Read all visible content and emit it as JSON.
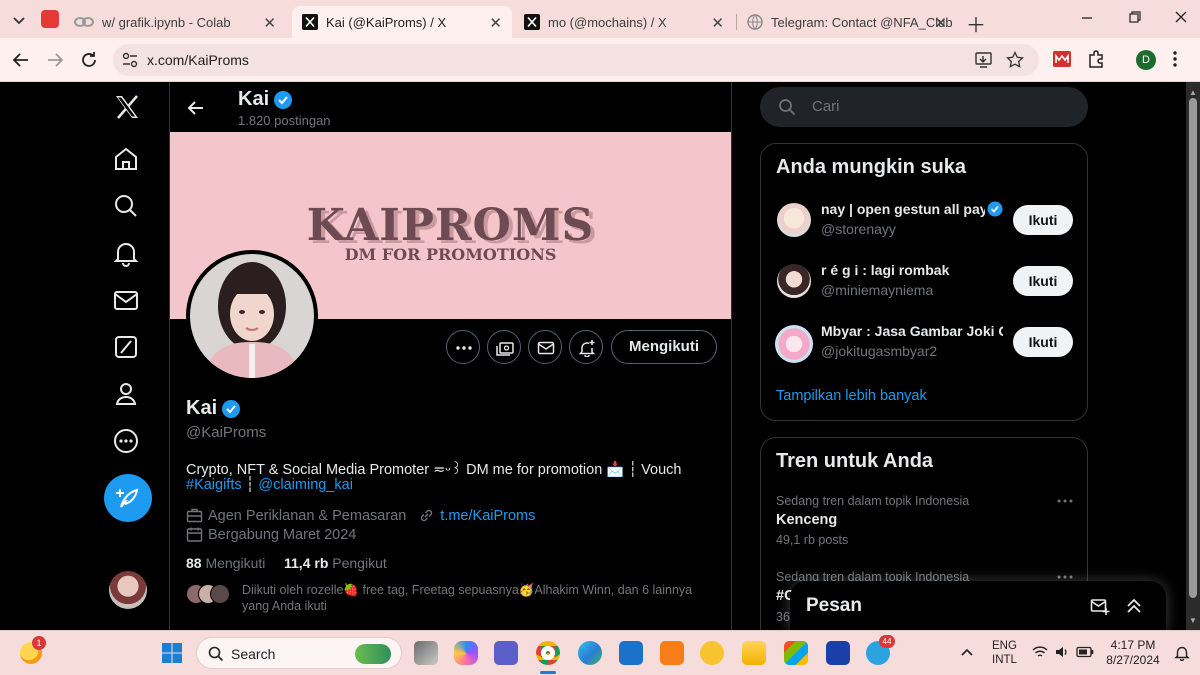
{
  "browser": {
    "tabs": [
      {
        "title": "w/ grafik.ipynb - Colab",
        "active": false
      },
      {
        "title": "Kai (@KaiProms) / X",
        "active": true
      },
      {
        "title": "mo (@mochains) / X",
        "active": false
      },
      {
        "title": "Telegram: Contact @NFA_Club",
        "active": false
      }
    ],
    "url": "x.com/KaiProms",
    "profile_letter": "D"
  },
  "header": {
    "name": "Kai",
    "post_count": "1.820 postingan"
  },
  "banner": {
    "title": "KAIPROMS",
    "subtitle": "DM FOR PROMOTIONS",
    "bg_color": "#f4c6cb"
  },
  "profile": {
    "follow_label": "Mengikuti",
    "name": "Kai",
    "handle": "@KaiProms",
    "bio_line1": "Crypto, NFT & Social Media Promoter ≂ᵕ꒱ DM me for promotion 📩 ┆ Vouch",
    "bio_tag1": "#Kaigifts",
    "bio_sep": " ┆ ",
    "bio_tag2": "@claiming_kai",
    "category": "Agen Periklanan & Pemasaran",
    "link": "t.me/KaiProms",
    "joined": "Bergabung Maret 2024",
    "following_count": "88",
    "following_label": "Mengikuti",
    "followers_count": "11,4 rb",
    "followers_label": "Pengikut",
    "followed_by_line1": "Diikuti oleh rozelle🍓 free tag, Freetag sepuasnya🥳Alhakim Winn, dan 6 lainnya",
    "followed_by_line2": "yang Anda ikuti"
  },
  "search": {
    "placeholder": "Cari"
  },
  "suggestions": {
    "title": "Anda mungkin suka",
    "button_label": "Ikuti",
    "items": [
      {
        "name": "nay | open gestun all pay",
        "handle": "@storenayy",
        "verified": true
      },
      {
        "name": "r é g i : lagi rombak",
        "handle": "@miniemayniema",
        "verified": false
      },
      {
        "name": "Mbyar : Jasa Gambar Joki G",
        "handle": "@jokitugasmbyar2",
        "verified": false
      }
    ],
    "show_more": "Tampilkan lebih banyak"
  },
  "trends": {
    "title": "Tren untuk Anda",
    "items": [
      {
        "context": "Sedang tren dalam topik Indonesia",
        "name": "Kenceng",
        "count": "49,1 rb posts"
      },
      {
        "context": "Sedang tren dalam topik Indonesia",
        "name": "#C",
        "count": "36"
      }
    ]
  },
  "messages": {
    "title": "Pesan"
  },
  "taskbar": {
    "search_label": "Search",
    "lang_line1": "ENG",
    "lang_line2": "INTL",
    "time": "4:17 PM",
    "date": "8/27/2024",
    "weather_badge": "1",
    "telegram_badge": "44"
  },
  "colors": {
    "accent": "#1d9bf0",
    "background": "#000000",
    "chrome": "#f6dcdb"
  }
}
